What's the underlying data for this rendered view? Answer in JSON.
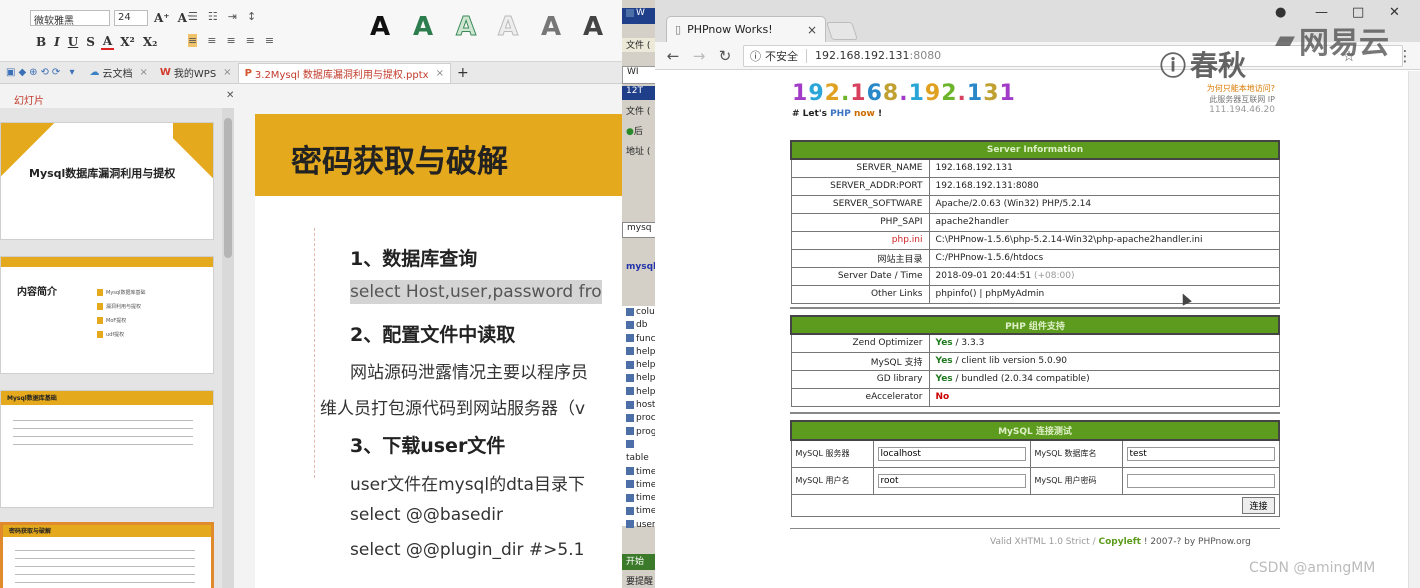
{
  "wps": {
    "ribbon": {
      "font_name": "微软雅黑",
      "font_size": "24",
      "format_buttons": [
        "B",
        "I",
        "U",
        "S",
        "A",
        "X²",
        "X₂"
      ],
      "style_letter": "A"
    },
    "tabs": [
      {
        "label": "云文档"
      },
      {
        "label": "我的WPS"
      },
      {
        "label": "3.2Mysql 数据库漏洞利用与提权.pptx"
      }
    ],
    "panel_title": "幻灯片",
    "thumbnails": [
      {
        "title": "Mysql数据库漏洞利用与提权"
      },
      {
        "title": "内容简介",
        "items": [
          "Mysql数据库基础",
          "漏洞利用与提权",
          "MoF提权",
          "udf提权"
        ]
      },
      {
        "title": "Mysql数据库基础"
      },
      {
        "title": "密码获取与破解"
      }
    ],
    "slide": {
      "title": "密码获取与破解",
      "lines": [
        {
          "text": "1、数据库查询",
          "style": "h"
        },
        {
          "text": "select Host,user,password fro",
          "style": "b",
          "highlight": true
        },
        {
          "text": "2、配置文件中读取",
          "style": "h"
        },
        {
          "text": "网站源码泄露情况主要以程序员",
          "style": "b"
        },
        {
          "text": "维人员打包源代码到网站服务器（v",
          "style": "b"
        },
        {
          "text": "3、下载user文件",
          "style": "h"
        },
        {
          "text": "user文件在mysql的dta目录下",
          "style": "b"
        },
        {
          "text": "select @@basedir",
          "style": "b"
        },
        {
          "text": "select @@plugin_dir  #>5.1",
          "style": "b"
        }
      ]
    }
  },
  "midwin": {
    "title_fragment": "W",
    "items": [
      "WI",
      "12T",
      "文件 (",
      "后",
      "地址 ("
    ],
    "field": "mysq",
    "link": "mysql",
    "list": [
      "colu",
      "db",
      "func",
      "help",
      "help",
      "help",
      "help",
      "host",
      "proc",
      "prog",
      "table",
      "time",
      "time",
      "time",
      "time",
      "user"
    ],
    "start": "开始",
    "status": "要提醒"
  },
  "chrome": {
    "tab_title": "PHPnow Works!",
    "tab_close": "×",
    "security_label": "不安全",
    "url_host": "192.168.192.131",
    "url_port": ":8080",
    "window_controls": [
      "●",
      "—",
      "□",
      "✕"
    ]
  },
  "phpnow": {
    "ip_heading": "192.168.192.131",
    "slogan_prefix": "# Let's ",
    "slogan_php": "PHP",
    "slogan_now": "now",
    "slogan_suffix": " !",
    "right_note_link": "为何只能本地访问?",
    "right_note_text": "此服务器互联网 IP",
    "right_ip": "111.194.46.20",
    "server_info": {
      "heading": "Server Information",
      "rows": [
        {
          "key": "SERVER_NAME",
          "value": "192.168.192.131"
        },
        {
          "key": "SERVER_ADDR:PORT",
          "value": "192.168.192.131:8080"
        },
        {
          "key": "SERVER_SOFTWARE",
          "value": "Apache/2.0.63 (Win32) PHP/5.2.14"
        },
        {
          "key": "PHP_SAPI",
          "value": "apache2handler"
        },
        {
          "key": "php.ini",
          "value": "C:\\PHPnow-1.5.6\\php-5.2.14-Win32\\php-apache2handler.ini",
          "key_red": true
        },
        {
          "key": "网站主目录",
          "value": "C:/PHPnow-1.5.6/htdocs"
        },
        {
          "key": "Server Date / Time",
          "value": "2018-09-01 20:44:51",
          "extra": "(+08:00)"
        },
        {
          "key": "Other Links",
          "value": "phpinfo() | phpMyAdmin"
        }
      ]
    },
    "components": {
      "heading": "PHP 组件支持",
      "rows": [
        {
          "key": "Zend Optimizer",
          "status": "Yes",
          "detail": " / 3.3.3"
        },
        {
          "key": "MySQL 支持",
          "status": "Yes",
          "detail": " / client lib version 5.0.90"
        },
        {
          "key": "GD library",
          "status": "Yes",
          "detail": " / bundled (2.0.34 compatible)"
        },
        {
          "key": "eAccelerator",
          "status": "No",
          "detail": ""
        }
      ]
    },
    "mysql_test": {
      "heading": "MySQL 连接测试",
      "server_label": "MySQL 服务器",
      "server_value": "localhost",
      "db_label": "MySQL 数据库名",
      "db_value": "test",
      "user_label": "MySQL 用户名",
      "user_value": "root",
      "pass_label": "MySQL 用户密码",
      "pass_value": "",
      "connect_label": "连接"
    },
    "footer": {
      "valid": "Valid XHTML 1.0 Strict",
      "sep": " / ",
      "copyleft": "Copyleft",
      "year": " ! 2007-? by ",
      "by": "PHPnow.org"
    }
  },
  "watermarks": {
    "chunqiu": "春秋",
    "wangyi": "网易云",
    "csdn": "CSDN @amingMM"
  }
}
